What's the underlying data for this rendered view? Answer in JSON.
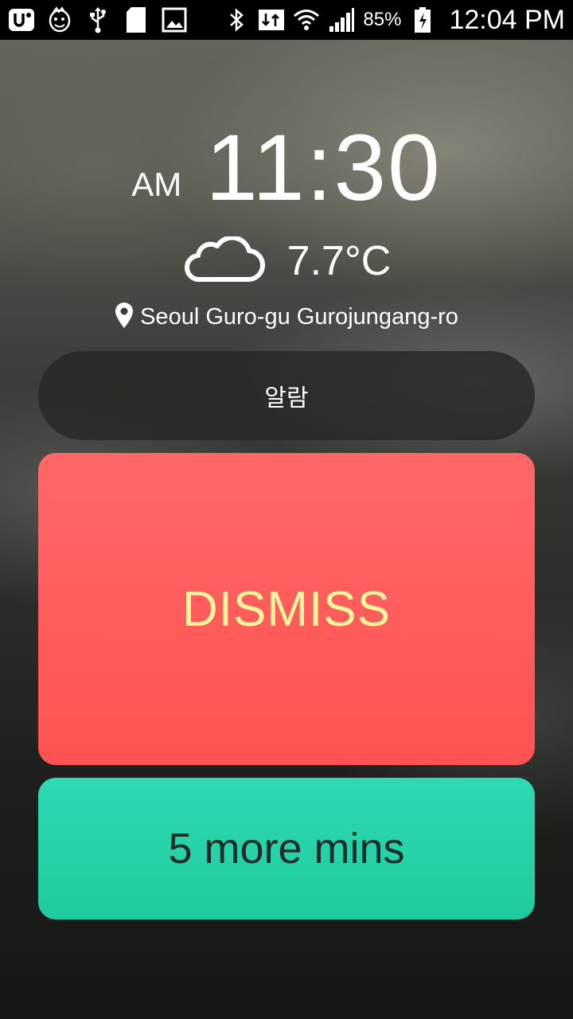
{
  "status_bar": {
    "icons": [
      "u-plus-icon",
      "face-sticker-icon",
      "usb-icon",
      "sd-card-icon",
      "image-icon",
      "bluetooth-icon",
      "data-transfer-icon",
      "wifi-icon",
      "signal-icon",
      "battery-charging-icon"
    ],
    "battery_percent": "85%",
    "time": "12:04 PM"
  },
  "alarm": {
    "ampm": "AM",
    "time": "11:30",
    "temperature": "7.7°C",
    "weather_icon": "cloud-icon",
    "location_icon": "location-pin-icon",
    "location": "Seoul Guro-gu Gurojungang-ro",
    "label": "알람"
  },
  "actions": {
    "dismiss_label": "DISMISS",
    "snooze_label": "5 more mins"
  },
  "colors": {
    "dismiss_bg": "#ff5a5a",
    "dismiss_text": "#fff59a",
    "snooze_bg": "#26d1a8",
    "snooze_text": "#1d2b2a"
  }
}
